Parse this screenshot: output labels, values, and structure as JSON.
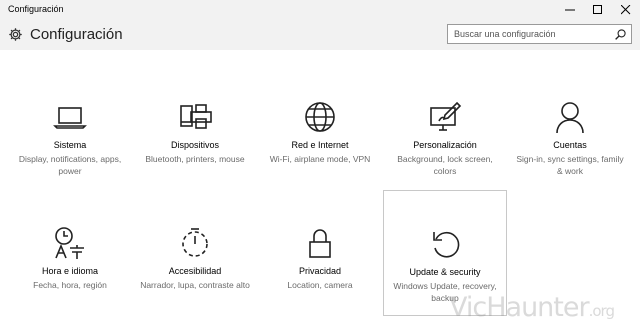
{
  "window": {
    "title": "Configuración"
  },
  "header": {
    "title": "Configuración",
    "icon": "gear-icon"
  },
  "search": {
    "placeholder": "Buscar una configuración",
    "value": ""
  },
  "tiles": [
    {
      "name": "Sistema",
      "desc": "Display, notifications, apps, power",
      "icon": "laptop-icon"
    },
    {
      "name": "Dispositivos",
      "desc": "Bluetooth, printers, mouse",
      "icon": "devices-printer-icon"
    },
    {
      "name": "Red e Internet",
      "desc": "Wi-Fi, airplane mode, VPN",
      "icon": "globe-icon"
    },
    {
      "name": "Personalización",
      "desc": "Background, lock screen, colors",
      "icon": "paint-monitor-icon"
    },
    {
      "name": "Cuentas",
      "desc": "Sign-in, sync settings, family & work",
      "icon": "person-icon"
    },
    {
      "name": "Hora e idioma",
      "desc": "Fecha, hora, región",
      "icon": "time-language-icon"
    },
    {
      "name": "Accesibilidad",
      "desc": "Narrador, lupa, contraste alto",
      "icon": "accessibility-timer-icon"
    },
    {
      "name": "Privacidad",
      "desc": "Location, camera",
      "icon": "lock-icon"
    },
    {
      "name": "Update & security",
      "desc": "Windows Update, recovery, backup",
      "icon": "refresh-icon",
      "selected": true
    }
  ],
  "watermark": {
    "text": "VicHaunter",
    "suffix": ".org"
  },
  "colors": {
    "chrome": "#f2f2f2",
    "text": "#000000",
    "secondary": "#6b6b6b",
    "selected_border": "#c8c8c8"
  }
}
